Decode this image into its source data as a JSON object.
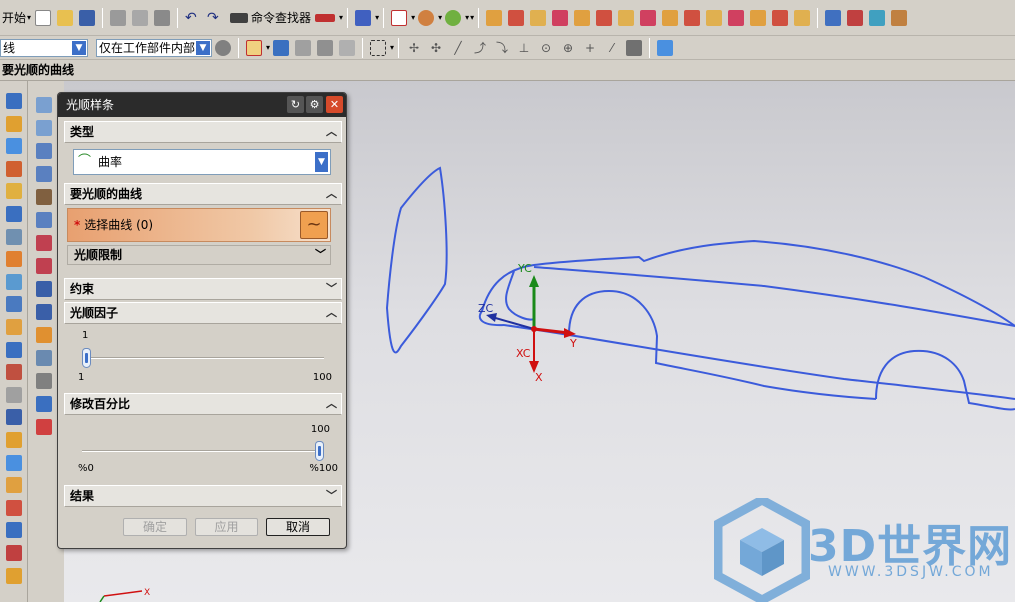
{
  "toolbar_top": {
    "start_label": "开始",
    "command_finder_label": "命令查找器"
  },
  "toolbar_second": {
    "filter_combo_value": "线",
    "scope_combo_value": "仅在工作部件内部"
  },
  "prompt": {
    "text": "要光顺的曲线"
  },
  "dialog": {
    "title": "光顺样条",
    "sections": {
      "type": {
        "header": "类型",
        "value": "曲率"
      },
      "curves": {
        "header": "要光顺的曲线",
        "select_label": "选择曲线 (0)",
        "limit_label": "光顺限制"
      },
      "constraint": {
        "header": "约束"
      },
      "factor": {
        "header": "光顺因子",
        "value": "1",
        "min": "1",
        "max": "100",
        "level": 0.0
      },
      "percent": {
        "header": "修改百分比",
        "value": "100",
        "min": "%0",
        "max": "%100",
        "level": 1.0
      },
      "result": {
        "header": "结果"
      }
    },
    "buttons": {
      "ok": "确定",
      "apply": "应用",
      "cancel": "取消"
    }
  },
  "viewport": {
    "axis_labels": {
      "xc": "XC",
      "yc": "YC",
      "zc": "ZC",
      "x": "X",
      "y": "Y"
    },
    "mini_triad_x": "X"
  },
  "watermark": {
    "title": "3D世界网",
    "url": "WWW.3DSJW.COM"
  },
  "colors": {
    "curve": "#3b5bdb",
    "dialog_title_bg": "#2b2b2b",
    "selection_row": "#e8a070",
    "close_button": "#d64a2a",
    "watermark": "#74a8d8"
  }
}
